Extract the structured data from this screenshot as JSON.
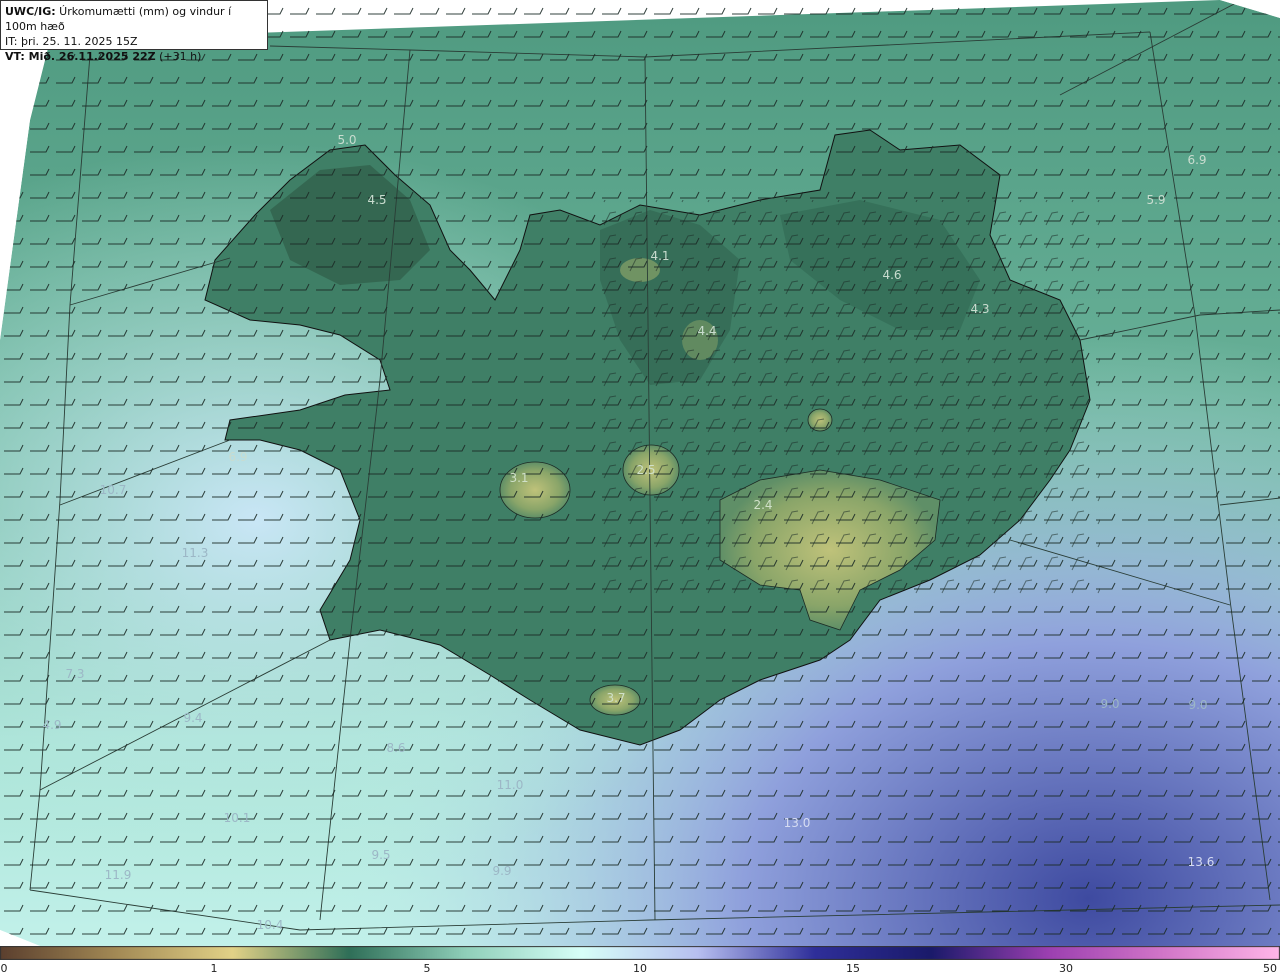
{
  "header": {
    "line1_prefix": "UWC/IG:",
    "line1_text": " Úrkomumætti (mm) og vindur í 100m hæð",
    "line2": "IT: þri. 25. 11. 2025 15Z",
    "line3_prefix": "VT: Mið. 26.11.2025 22Z",
    "line3_suffix": " (+31 h)"
  },
  "values": [
    {
      "t": "5.0"
    },
    {
      "t": "4.5"
    },
    {
      "t": "4.1"
    },
    {
      "t": "4.6"
    },
    {
      "t": "4.3"
    },
    {
      "t": "6.9"
    },
    {
      "t": "5.9"
    },
    {
      "t": "4.4"
    },
    {
      "t": "3.1"
    },
    {
      "t": "2.5"
    },
    {
      "t": "2.4"
    },
    {
      "t": "3.7"
    },
    {
      "t": "6.9"
    },
    {
      "t": "7.3"
    },
    {
      "t": "4.9"
    },
    {
      "t": "9.4"
    },
    {
      "t": "8.6"
    },
    {
      "t": "9.0"
    },
    {
      "t": "13.0"
    },
    {
      "t": "13.6"
    },
    {
      "t": "10.7"
    },
    {
      "t": "11.3"
    },
    {
      "t": "11.0"
    },
    {
      "t": "10.1"
    },
    {
      "t": "9.5"
    },
    {
      "t": "11.9"
    },
    {
      "t": "9.9"
    },
    {
      "t": "10.4"
    },
    {
      "t": "9.0"
    }
  ],
  "colorbar": {
    "ticks": [
      "0",
      "1",
      "5",
      "10",
      "15",
      "30",
      "50"
    ],
    "colors": [
      "#5b3f2e",
      "#a38a55",
      "#e2d287",
      "#2f6f58",
      "#8fcfb9",
      "#d7fff8",
      "#b7bff0",
      "#2f2f9a",
      "#1a1a6a",
      "#9b3fb0",
      "#d276c8",
      "#ffb6e8"
    ]
  }
}
